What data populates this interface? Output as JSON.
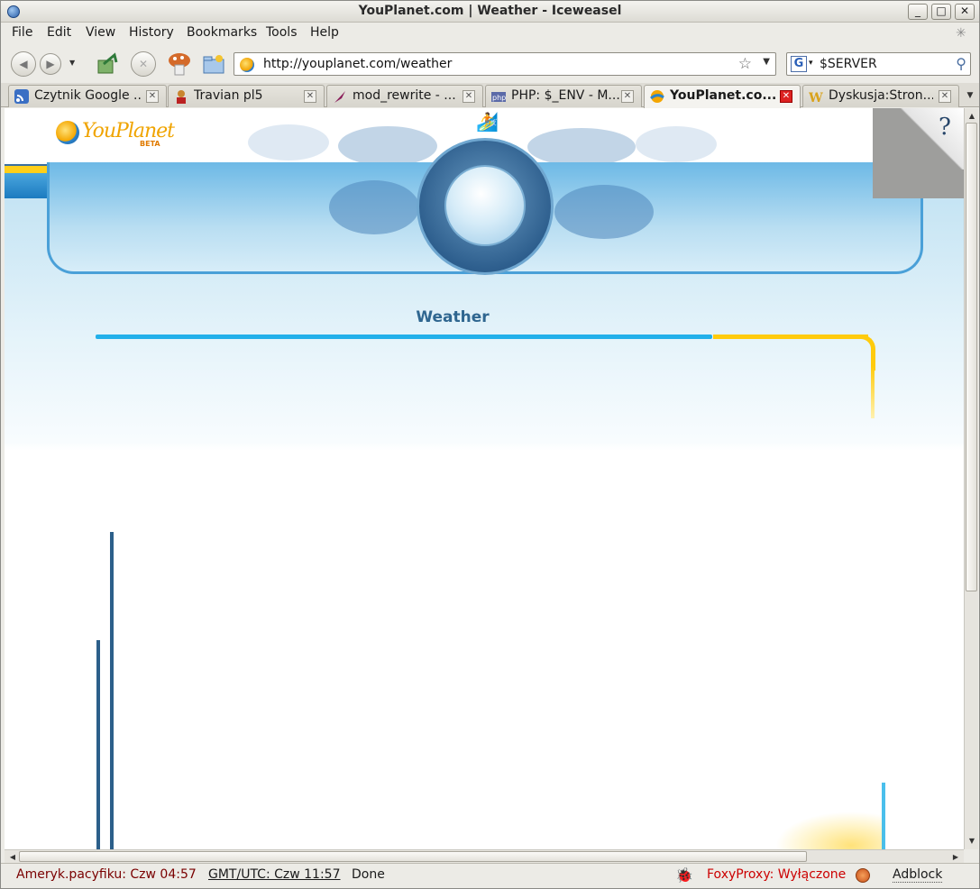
{
  "window": {
    "title": "YouPlanet.com | Weather - Iceweasel",
    "buttons": {
      "minimize": "_",
      "maximize": "□",
      "close": "✕"
    }
  },
  "menu": [
    "File",
    "Edit",
    "View",
    "History",
    "Bookmarks",
    "Tools",
    "Help"
  ],
  "navigation": {
    "url": "http://youplanet.com/weather",
    "search_engine_letter": "G",
    "search_value": "$SERVER"
  },
  "tabs": [
    {
      "label": "Czytnik Google ...",
      "icon": "rss-icon",
      "active": false
    },
    {
      "label": "Travian pl5",
      "icon": "travian-icon",
      "active": false
    },
    {
      "label": "mod_rewrite - ...",
      "icon": "feather-icon",
      "active": false
    },
    {
      "label": "PHP: $_ENV - M...",
      "icon": "php-icon",
      "active": false
    },
    {
      "label": "YouPlanet.co...",
      "icon": "youplanet-icon",
      "active": true
    },
    {
      "label": "Dyskusja:Stron...",
      "icon": "wiki-icon",
      "active": false
    }
  ],
  "page": {
    "logo_text": "YouPlanet",
    "logo_beta": "BETA",
    "help_symbol": "?",
    "section_title": "Weather"
  },
  "status": {
    "clock_pacific": "Ameryk.pacyfiku: Czw 04:57",
    "clock_gmt": "GMT/UTC: Czw 11:57",
    "state": "Done",
    "foxyproxy": "FoxyProxy: Wyłączone",
    "adblock": "Adblock"
  },
  "colors": {
    "accent_blue": "#22b0ea",
    "accent_yellow": "#ffcb0c",
    "title_blue": "#2f6690",
    "status_red": "#cc0000",
    "status_dark_red": "#7a0000"
  }
}
